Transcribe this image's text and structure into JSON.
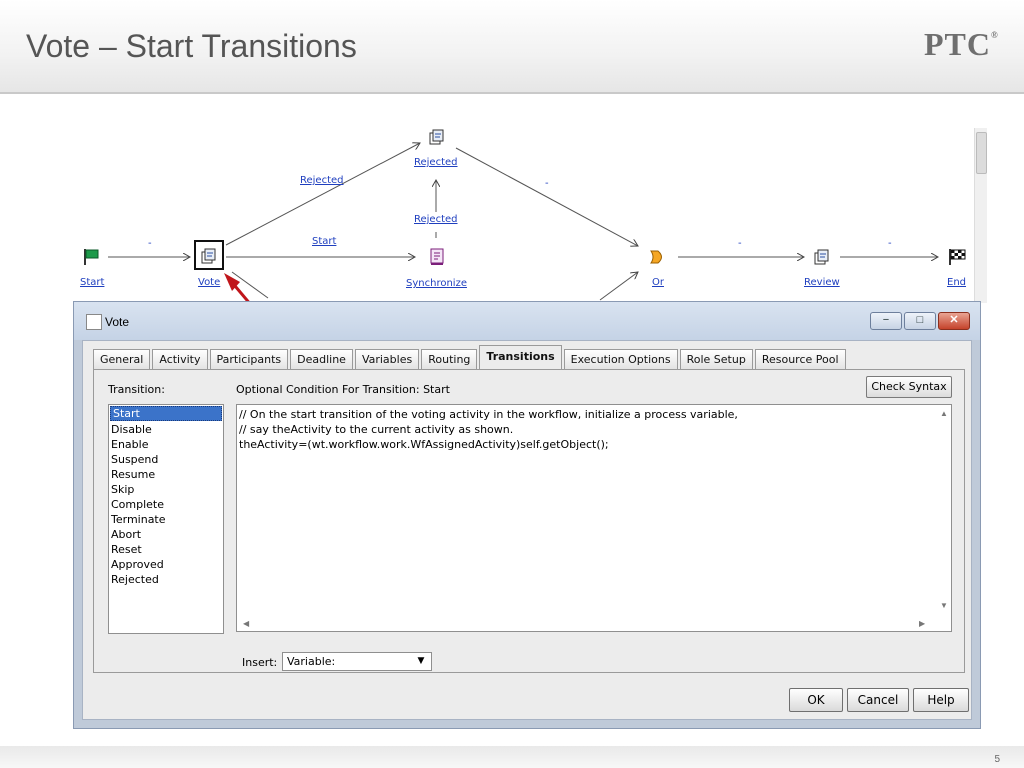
{
  "slide": {
    "title": "Vote – Start Transitions",
    "logo_text": "PTC",
    "logo_mark": "®",
    "page_number": "5"
  },
  "workflow": {
    "nodes": {
      "start": "Start",
      "vote": "Vote",
      "synchronize": "Synchronize",
      "rejected_task": "Rejected",
      "or": "Or",
      "review": "Review",
      "end": "End"
    },
    "links": {
      "start_to_vote": "-",
      "vote_rejected": "Rejected",
      "vote_start": "Start",
      "sync_rejected": "Rejected",
      "rejected_to_or": "-",
      "or_to_review": "-",
      "review_to_end": "-"
    }
  },
  "dialog": {
    "title": "Vote",
    "window_buttons": {
      "minimize": "−",
      "maximize": "□",
      "close": "✕"
    },
    "tabs": [
      "General",
      "Activity",
      "Participants",
      "Deadline",
      "Variables",
      "Routing",
      "Transitions",
      "Execution Options",
      "Role Setup",
      "Resource Pool"
    ],
    "active_tab": "Transitions",
    "transition_label": "Transition:",
    "condition_label": "Optional Condition For Transition: Start",
    "check_syntax": "Check Syntax",
    "transitions": [
      "Start",
      "Disable",
      "Enable",
      "Suspend",
      "Resume",
      "Skip",
      "Complete",
      "Terminate",
      "Abort",
      "Reset",
      "Approved",
      "Rejected"
    ],
    "selected_transition": "Start",
    "code": [
      "// On the start transition of the voting activity in the workflow, initialize a process variable,",
      "// say theActivity to the current activity as shown.",
      "theActivity=(wt.workflow.work.WfAssignedActivity)self.getObject();"
    ],
    "insert_label": "Insert:",
    "insert_value": "Variable:",
    "buttons": {
      "ok": "OK",
      "cancel": "Cancel",
      "help": "Help"
    }
  },
  "colors": {
    "link_blue": "#1f3fbf",
    "annotation_red": "#c0161b",
    "selection_blue": "#3b73c9"
  }
}
